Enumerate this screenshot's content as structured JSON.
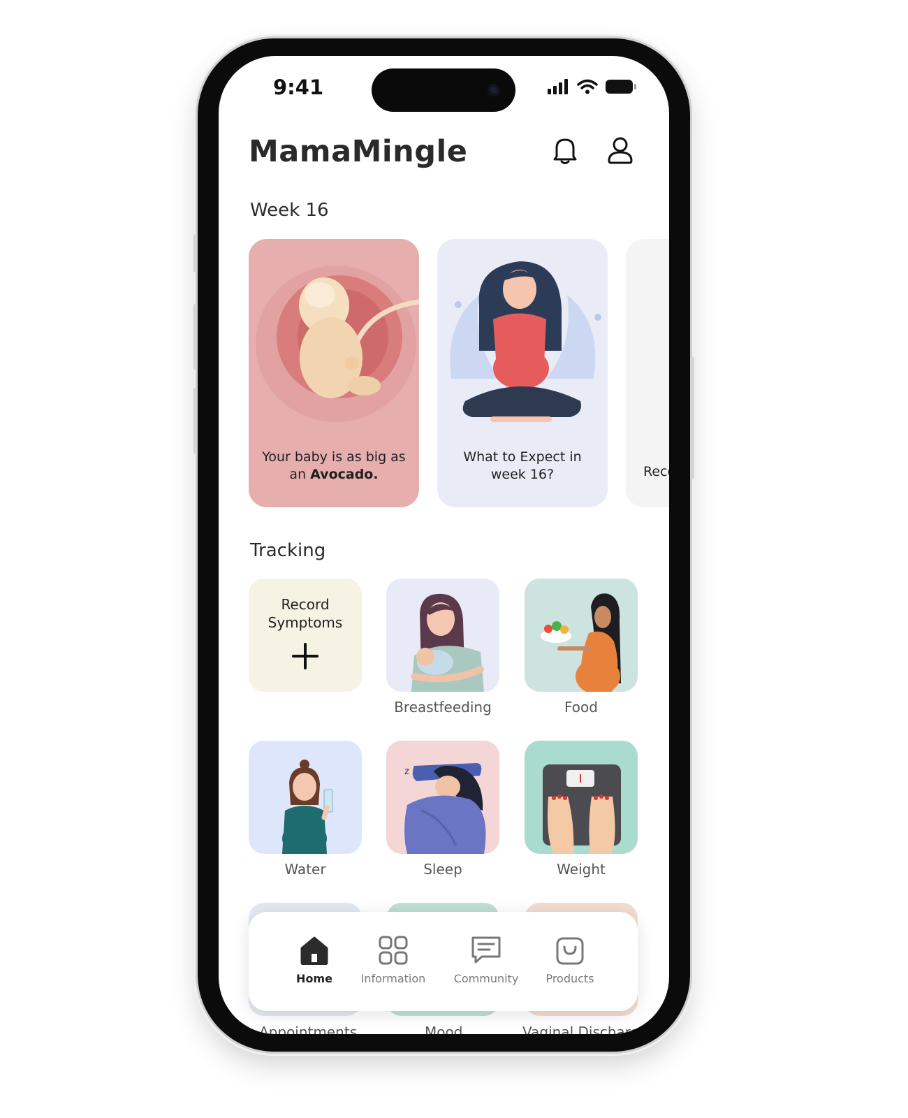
{
  "status_bar": {
    "time": "9:41"
  },
  "app": {
    "title": "MamaMingle"
  },
  "icons": {
    "notifications": "bell-icon",
    "profile": "user-icon"
  },
  "week": {
    "title": "Week 16",
    "cards": [
      {
        "text_before": "Your baby is as big as an ",
        "text_bold": "Avocado.",
        "bg": "#e7aeae"
      },
      {
        "text": "What to Expect in week 16?",
        "bg": "#e9ecf7"
      },
      {
        "text": "Reco",
        "bg": "#f4f4f4"
      }
    ]
  },
  "tracking": {
    "title": "Tracking",
    "record_symptoms": "Record Symptoms",
    "items": [
      {
        "label": "Breastfeeding",
        "bg": "#e8ebf7"
      },
      {
        "label": "Food",
        "bg": "#cde3df"
      },
      {
        "label": "Water",
        "bg": "#dde6fb"
      },
      {
        "label": "Sleep",
        "bg": "#f5d6d6"
      },
      {
        "label": "Weight",
        "bg": "#a9dccf"
      },
      {
        "label": "Appointments"
      },
      {
        "label": "Mood"
      },
      {
        "label": "Vaginal Discharg"
      }
    ]
  },
  "nav": {
    "items": [
      {
        "label": "Home",
        "icon": "home-icon",
        "active": true
      },
      {
        "label": "Information",
        "icon": "grid-icon"
      },
      {
        "label": "Community",
        "icon": "chat-icon"
      },
      {
        "label": "Products",
        "icon": "bag-icon"
      }
    ]
  }
}
